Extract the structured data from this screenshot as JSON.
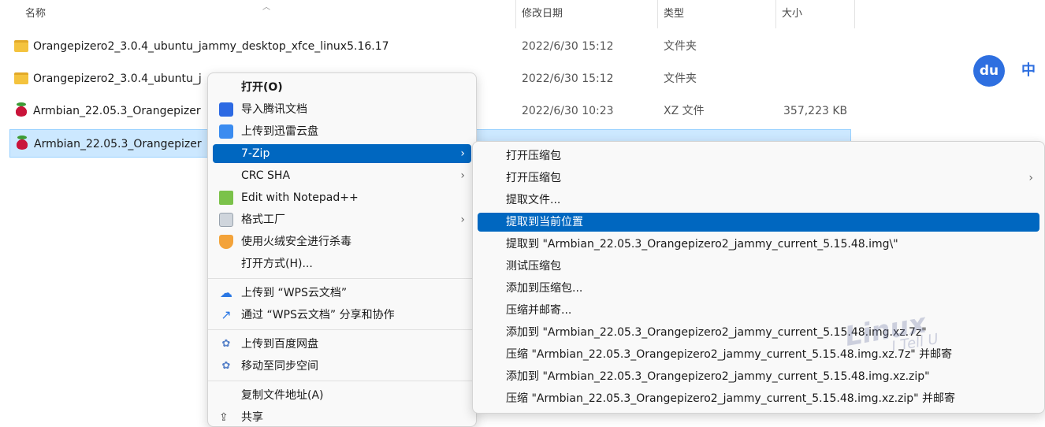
{
  "header": {
    "col_name": "名称",
    "col_date": "修改日期",
    "col_type": "类型",
    "col_size": "大小",
    "sort_indicator": "︿"
  },
  "files": [
    {
      "name": "Orangepizero2_3.0.4_ubuntu_jammy_desktop_xfce_linux5.16.17",
      "date": "2022/6/30 15:12",
      "type": "文件夹",
      "size": "",
      "icon": "folder-icon"
    },
    {
      "name": "Orangepizero2_3.0.4_ubuntu_j",
      "date": "2022/6/30 15:12",
      "type": "文件夹",
      "size": "",
      "icon": "folder-icon"
    },
    {
      "name": "Armbian_22.05.3_Orangepizer",
      "date": "2022/6/30 10:23",
      "type": "XZ 文件",
      "size": "357,223 KB",
      "icon": "raspberry-icon"
    },
    {
      "name": "Armbian_22.05.3_Orangepizer",
      "date": "",
      "type": "",
      "size": "",
      "icon": "raspberry-icon"
    }
  ],
  "context_menu": {
    "open": "打开(O)",
    "import_tencent": "导入腾讯文档",
    "upload_xunlei": "上传到迅雷云盘",
    "zip7": "7-Zip",
    "crc_sha": "CRC SHA",
    "notepad": "Edit with Notepad++",
    "format_factory": "格式工厂",
    "huorong": "使用火绒安全进行杀毒",
    "open_with": "打开方式(H)...",
    "upload_wps": "上传到 “WPS云文档”",
    "share_wps": "通过 “WPS云文档” 分享和协作",
    "upload_baidu": "上传到百度网盘",
    "move_sync": "移动至同步空间",
    "copy_path": "复制文件地址(A)",
    "cutoff": "共享"
  },
  "submenu_7zip": {
    "items": [
      "打开压缩包",
      "打开压缩包",
      "提取文件...",
      "提取到当前位置",
      "提取到 \"Armbian_22.05.3_Orangepizero2_jammy_current_5.15.48.img\\\"",
      "测试压缩包",
      "添加到压缩包...",
      "压缩并邮寄...",
      "添加到 \"Armbian_22.05.3_Orangepizero2_jammy_current_5.15.48.img.xz.7z\"",
      "压缩 \"Armbian_22.05.3_Orangepizero2_jammy_current_5.15.48.img.xz.7z\" 并邮寄",
      "添加到 \"Armbian_22.05.3_Orangepizero2_jammy_current_5.15.48.img.xz.zip\"",
      "压缩 \"Armbian_22.05.3_Orangepizero2_jammy_current_5.15.48.img.xz.zip\" 并邮寄"
    ],
    "highlighted_index": 3
  },
  "ime": {
    "logo": "du",
    "mode": "中"
  },
  "watermark": {
    "main": "Linux",
    "sub": "I Tell U"
  },
  "colors": {
    "highlight": "#0067c0",
    "selection": "#cce8ff",
    "ime_blue": "#2e6fe0"
  }
}
